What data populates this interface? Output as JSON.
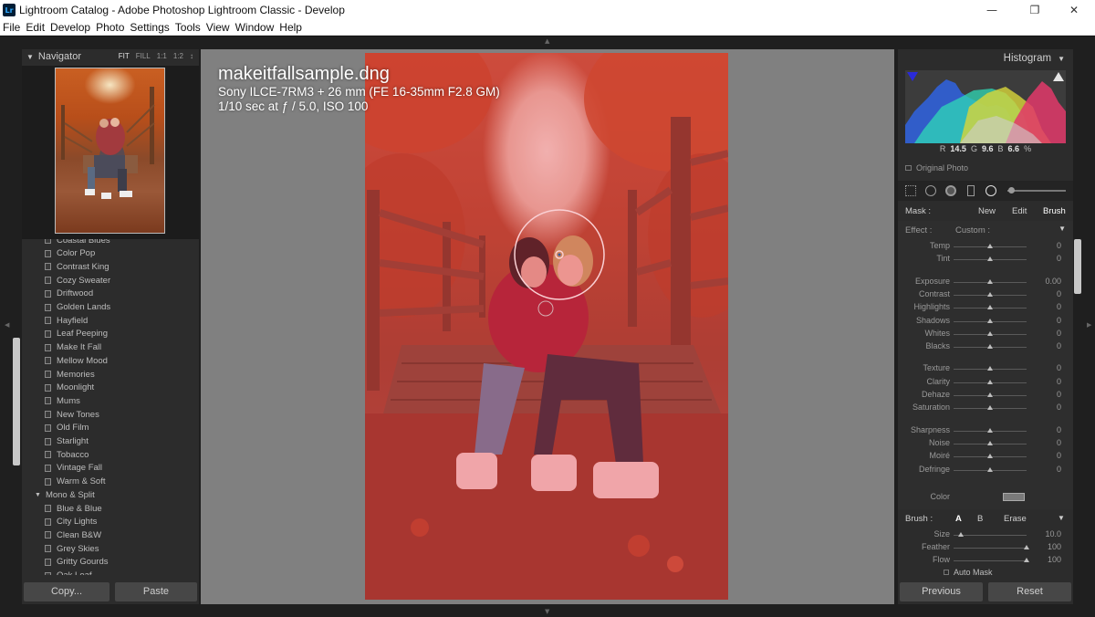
{
  "window": {
    "title": "Lightroom Catalog - Adobe Photoshop Lightroom Classic - Develop",
    "app_icon": "Lr",
    "controls": [
      "minimize-icon",
      "maximize-icon",
      "close-icon"
    ]
  },
  "menu": [
    "File",
    "Edit",
    "Develop",
    "Photo",
    "Settings",
    "Tools",
    "View",
    "Window",
    "Help"
  ],
  "navigator": {
    "title": "Navigator",
    "zoom_options": [
      "FIT",
      "FILL",
      "1:1",
      "1:2"
    ],
    "active_zoom": "FIT"
  },
  "presets": {
    "items": [
      {
        "label": "Coastal Blues",
        "type": "preset"
      },
      {
        "label": "Color Pop",
        "type": "preset"
      },
      {
        "label": "Contrast King",
        "type": "preset"
      },
      {
        "label": "Cozy Sweater",
        "type": "preset"
      },
      {
        "label": "Driftwood",
        "type": "preset"
      },
      {
        "label": "Golden Lands",
        "type": "preset"
      },
      {
        "label": "Hayfield",
        "type": "preset"
      },
      {
        "label": "Leaf Peeping",
        "type": "preset"
      },
      {
        "label": "Make It Fall",
        "type": "preset"
      },
      {
        "label": "Mellow Mood",
        "type": "preset"
      },
      {
        "label": "Memories",
        "type": "preset"
      },
      {
        "label": "Moonlight",
        "type": "preset"
      },
      {
        "label": "Mums",
        "type": "preset"
      },
      {
        "label": "New Tones",
        "type": "preset"
      },
      {
        "label": "Old Film",
        "type": "preset"
      },
      {
        "label": "Starlight",
        "type": "preset"
      },
      {
        "label": "Tobacco",
        "type": "preset"
      },
      {
        "label": "Vintage Fall",
        "type": "preset"
      },
      {
        "label": "Warm & Soft",
        "type": "preset"
      },
      {
        "label": "Mono & Split",
        "type": "group"
      },
      {
        "label": "Blue & Blue",
        "type": "preset"
      },
      {
        "label": "City Lights",
        "type": "preset"
      },
      {
        "label": "Clean B&W",
        "type": "preset"
      },
      {
        "label": "Grey Skies",
        "type": "preset"
      },
      {
        "label": "Gritty Gourds",
        "type": "preset"
      },
      {
        "label": "Oak Leaf",
        "type": "preset"
      }
    ]
  },
  "left_buttons": {
    "copy": "Copy...",
    "paste": "Paste"
  },
  "photo_info": {
    "filename": "makeitfallsample.dng",
    "camera": "Sony ILCE-7RM3 + 26 mm (FE 16-35mm F2.8 GM)",
    "exposure": "1/10 sec at ƒ / 5.0, ISO 100"
  },
  "histogram": {
    "title": "Histogram",
    "readout": {
      "r_label": "R",
      "r": "14.5",
      "g_label": "G",
      "g": "9.6",
      "b_label": "B",
      "b": "6.6",
      "unit": "%"
    },
    "original_photo": "Original Photo"
  },
  "mask": {
    "label": "Mask :",
    "new": "New",
    "edit": "Edit",
    "brush": "Brush"
  },
  "effect": {
    "label": "Effect :",
    "value": "Custom :",
    "sliders": [
      {
        "label": "Temp",
        "value": "0",
        "pos": 0.5,
        "group": 0
      },
      {
        "label": "Tint",
        "value": "0",
        "pos": 0.5,
        "group": 0
      },
      {
        "label": "Exposure",
        "value": "0.00",
        "pos": 0.5,
        "group": 1
      },
      {
        "label": "Contrast",
        "value": "0",
        "pos": 0.5,
        "group": 1
      },
      {
        "label": "Highlights",
        "value": "0",
        "pos": 0.5,
        "group": 1
      },
      {
        "label": "Shadows",
        "value": "0",
        "pos": 0.5,
        "group": 1
      },
      {
        "label": "Whites",
        "value": "0",
        "pos": 0.5,
        "group": 1
      },
      {
        "label": "Blacks",
        "value": "0",
        "pos": 0.5,
        "group": 1
      },
      {
        "label": "Texture",
        "value": "0",
        "pos": 0.5,
        "group": 2
      },
      {
        "label": "Clarity",
        "value": "0",
        "pos": 0.5,
        "group": 2
      },
      {
        "label": "Dehaze",
        "value": "0",
        "pos": 0.5,
        "group": 2
      },
      {
        "label": "Saturation",
        "value": "0",
        "pos": 0.5,
        "group": 2
      },
      {
        "label": "Sharpness",
        "value": "0",
        "pos": 0.5,
        "group": 3
      },
      {
        "label": "Noise",
        "value": "0",
        "pos": 0.5,
        "group": 3
      },
      {
        "label": "Moiré",
        "value": "0",
        "pos": 0.5,
        "group": 3
      },
      {
        "label": "Defringe",
        "value": "0",
        "pos": 0.5,
        "group": 3
      }
    ],
    "color_label": "Color"
  },
  "brush": {
    "label": "Brush :",
    "a": "A",
    "b": "B",
    "erase": "Erase",
    "sliders": [
      {
        "label": "Size",
        "value": "10.0",
        "pos": 0.1
      },
      {
        "label": "Feather",
        "value": "100",
        "pos": 1.0
      },
      {
        "label": "Flow",
        "value": "100",
        "pos": 1.0
      }
    ],
    "auto_mask": "Auto Mask"
  },
  "right_buttons": {
    "previous": "Previous",
    "reset": "Reset"
  },
  "colors": {
    "panel": "#2c2c2c",
    "workspace": "#808080",
    "mask_overlay": "#e6283c"
  }
}
